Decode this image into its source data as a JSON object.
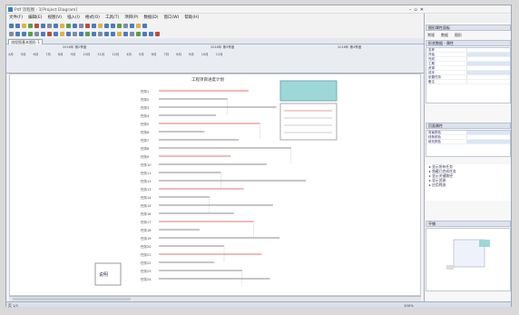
{
  "window": {
    "title": "Pdf 流程图 - 1[Project Diagram]"
  },
  "menu": [
    "文件(F)",
    "编辑(E)",
    "视图(V)",
    "插入(I)",
    "格式(O)",
    "工具(T)",
    "项目(P)",
    "数据(D)",
    "窗口(W)",
    "帮助(H)"
  ],
  "toolbar1_colors": [
    "#4a7bc0",
    "#4a7bc0",
    "#e0b440",
    "#56a04a",
    "#c04a3c",
    "#4a7bc0",
    "#7a8ea6",
    "#4a7bc0",
    "#e0b440",
    "#56a04a",
    "#4a7bc0",
    "#7a8ea6",
    "#c04a3c",
    "#4a7bc0",
    "#e0b440",
    "#4a7bc0",
    "#4a7bc0",
    "#56a04a",
    "#7a8ea6",
    "#4a7bc0",
    "#e0b440",
    "#4a7bc0"
  ],
  "toolbar2_colors": [
    "#7a8ea6",
    "#4a7bc0",
    "#4a7bc0",
    "#56a04a",
    "#7a8ea6",
    "#4a7bc0",
    "#c04a3c",
    "#4a7bc0",
    "#e0b440",
    "#4a7bc0",
    "#7a8ea6",
    "#4a7bc0",
    "#56a04a",
    "#4a7bc0",
    "#7a8ea6",
    "#4a7bc0",
    "#4a7bc0",
    "#e0b440",
    "#4a7bc0",
    "#7a8ea6",
    "#56a04a",
    "#4a7bc0",
    "#4a7bc0",
    "#c04a3c"
  ],
  "tab": {
    "label": "流程图基本图形 1"
  },
  "ruler": {
    "groups": [
      "2016年 第2季度",
      "2016年 第3季度",
      "2016年 第4季度"
    ],
    "columns": [
      "4月",
      "5月",
      "6月",
      "7月",
      "8月",
      "9月",
      "10月",
      "11月",
      "12月",
      "4月",
      "5月",
      "6月",
      "7月",
      "8月",
      "9月",
      "10月",
      "11月"
    ]
  },
  "diagram": {
    "title": "工程项目进度计划",
    "legend_label": "说明"
  },
  "right_panel": {
    "title": "图形属性面板",
    "tabs": [
      "常规",
      "数据",
      "图形"
    ],
    "section1": "形状数据 - 属性",
    "grid1": [
      {
        "k": "名称",
        "blue": false
      },
      {
        "k": "开始",
        "blue": true
      },
      {
        "k": "完成",
        "blue": false
      },
      {
        "k": "工期",
        "blue": true
      },
      {
        "k": "资源",
        "blue": false
      },
      {
        "k": "成本",
        "blue": true
      },
      {
        "k": "前置任务",
        "blue": false
      },
      {
        "k": "备注",
        "blue": false
      }
    ],
    "section2": "页面属性",
    "grid2": [
      {
        "k": "背景颜色",
        "blue": true
      },
      {
        "k": "线条颜色",
        "blue": false
      },
      {
        "k": "填充颜色",
        "blue": true
      }
    ],
    "tree": [
      "显示所有任务",
      "隐藏已完成任务",
      "显示关键路径",
      "显示资源",
      "应用筛选"
    ],
    "nav_title": "平铺"
  },
  "status": {
    "left": "页 1/1",
    "right": "100%"
  },
  "gantt_rows": [
    {
      "label": "任务1",
      "len": 0.55,
      "color": "#d44"
    },
    {
      "label": "任务2",
      "len": 0.42,
      "color": "#666"
    },
    {
      "label": "任务3",
      "len": 0.72,
      "color": "#666"
    },
    {
      "label": "任务4",
      "len": 0.35,
      "color": "#666"
    },
    {
      "label": "任务5",
      "len": 0.62,
      "color": "#d44"
    },
    {
      "label": "任务6",
      "len": 0.28,
      "color": "#666"
    },
    {
      "label": "任务7",
      "len": 0.49,
      "color": "#666"
    },
    {
      "label": "任务8",
      "len": 0.81,
      "color": "#666"
    },
    {
      "label": "任务9",
      "len": 0.44,
      "color": "#d44"
    },
    {
      "label": "任务10",
      "len": 0.66,
      "color": "#666"
    },
    {
      "label": "任务11",
      "len": 0.38,
      "color": "#666"
    },
    {
      "label": "任务12",
      "len": 0.9,
      "color": "#666"
    },
    {
      "label": "任务13",
      "len": 0.52,
      "color": "#d44"
    },
    {
      "label": "任务14",
      "len": 0.31,
      "color": "#666"
    },
    {
      "label": "任务15",
      "len": 0.7,
      "color": "#666"
    },
    {
      "label": "任务16",
      "len": 0.46,
      "color": "#666"
    },
    {
      "label": "任务17",
      "len": 0.58,
      "color": "#d44"
    },
    {
      "label": "任务18",
      "len": 0.25,
      "color": "#666"
    },
    {
      "label": "任务19",
      "len": 0.74,
      "color": "#666"
    },
    {
      "label": "任务20",
      "len": 0.4,
      "color": "#666"
    },
    {
      "label": "任务21",
      "len": 0.63,
      "color": "#d44"
    },
    {
      "label": "任务22",
      "len": 0.34,
      "color": "#666"
    },
    {
      "label": "任务23",
      "len": 0.51,
      "color": "#666"
    },
    {
      "label": "任务24",
      "len": 0.68,
      "color": "#666"
    }
  ]
}
